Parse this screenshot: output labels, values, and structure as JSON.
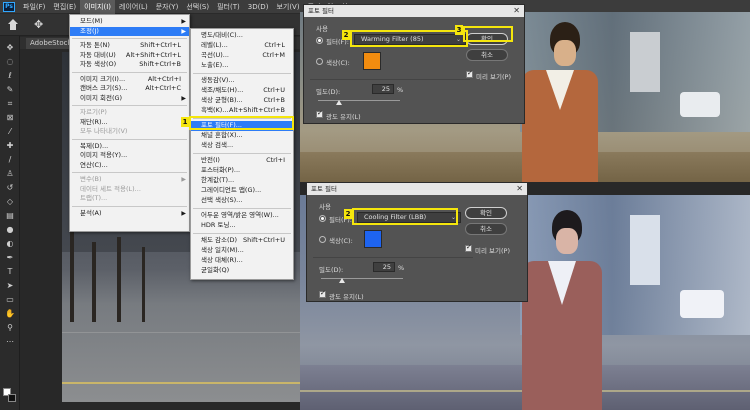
{
  "menubar": {
    "logo": "Ps",
    "items": [
      "파일(F)",
      "편집(E)",
      "이미지(I)",
      "레이어(L)",
      "문자(Y)",
      "선택(S)",
      "필터(T)",
      "3D(D)",
      "보기(V)",
      "플러그인",
      "창"
    ]
  },
  "document": {
    "tab_label": "AdobeStock_..."
  },
  "image_menu": {
    "rows": [
      {
        "label": "모드(M)",
        "shortcut": "",
        "submenu": true,
        "disabled": false
      },
      {
        "label": "조정(J)",
        "shortcut": "",
        "submenu": true,
        "disabled": false,
        "highlight": true
      },
      {
        "label": "자동 톤(N)",
        "shortcut": "Shift+Ctrl+L",
        "disabled": false
      },
      {
        "label": "자동 대비(U)",
        "shortcut": "Alt+Shift+Ctrl+L",
        "disabled": false
      },
      {
        "label": "자동 색상(O)",
        "shortcut": "Shift+Ctrl+B",
        "disabled": false
      },
      {
        "label": "이미지 크기(I)...",
        "shortcut": "Alt+Ctrl+I",
        "disabled": false
      },
      {
        "label": "캔버스 크기(S)...",
        "shortcut": "Alt+Ctrl+C",
        "disabled": false
      },
      {
        "label": "이미지 회전(G)",
        "shortcut": "",
        "submenu": true,
        "disabled": false
      },
      {
        "label": "자르기(P)",
        "shortcut": "",
        "disabled": true
      },
      {
        "label": "재단(R)...",
        "shortcut": "",
        "disabled": false
      },
      {
        "label": "모두 나타내기(V)",
        "shortcut": "",
        "disabled": true
      },
      {
        "label": "복제(D)...",
        "shortcut": "",
        "disabled": false
      },
      {
        "label": "이미지 적용(Y)...",
        "shortcut": "",
        "disabled": false
      },
      {
        "label": "연산(C)...",
        "shortcut": "",
        "disabled": false
      },
      {
        "label": "변수(B)",
        "shortcut": "",
        "submenu": true,
        "disabled": true
      },
      {
        "label": "데이터 세트 적용(L)...",
        "shortcut": "",
        "disabled": true
      },
      {
        "label": "트랩(T)...",
        "shortcut": "",
        "disabled": true
      },
      {
        "label": "분석(A)",
        "shortcut": "",
        "submenu": true,
        "disabled": false
      }
    ]
  },
  "adjust_menu": {
    "rows": [
      {
        "label": "명도/대비(C)...",
        "shortcut": ""
      },
      {
        "label": "레벨(L)...",
        "shortcut": "Ctrl+L"
      },
      {
        "label": "곡선(U)...",
        "shortcut": "Ctrl+M"
      },
      {
        "label": "노출(E)...",
        "shortcut": ""
      },
      {
        "label": "생동감(V)...",
        "shortcut": ""
      },
      {
        "label": "색조/채도(H)...",
        "shortcut": "Ctrl+U"
      },
      {
        "label": "색상 균형(B)...",
        "shortcut": "Ctrl+B"
      },
      {
        "label": "흑백(K)...",
        "shortcut": "Alt+Shift+Ctrl+B"
      },
      {
        "label": "포토 필터(F)...",
        "shortcut": "",
        "highlight": true
      },
      {
        "label": "채널 혼합(X)...",
        "shortcut": ""
      },
      {
        "label": "색상 검색...",
        "shortcut": ""
      },
      {
        "label": "반전(I)",
        "shortcut": "Ctrl+I"
      },
      {
        "label": "포스터화(P)...",
        "shortcut": ""
      },
      {
        "label": "한계값(T)...",
        "shortcut": ""
      },
      {
        "label": "그레이디언트 맵(G)...",
        "shortcut": ""
      },
      {
        "label": "선택 색상(S)...",
        "shortcut": ""
      },
      {
        "label": "어두운 영역/밝은 영역(W)...",
        "shortcut": ""
      },
      {
        "label": "HDR 토닝...",
        "shortcut": ""
      },
      {
        "label": "채도 감소(D)",
        "shortcut": "Shift+Ctrl+U"
      },
      {
        "label": "색상 일치(M)...",
        "shortcut": ""
      },
      {
        "label": "색상 대체(R)...",
        "shortcut": ""
      },
      {
        "label": "균일화(Q)",
        "shortcut": ""
      }
    ]
  },
  "dialog_warm": {
    "title": "포토 필터",
    "use_label": "사용",
    "filter_label": "필터(F):",
    "filter_value": "Warming Filter (85)",
    "color_label": "색상(C):",
    "color": "#f28c0f",
    "density_label": "밀도(D):",
    "density_value": "25",
    "density_unit": "%",
    "density_percent": 25,
    "preserve_label": "광도 유지(L)",
    "ok_label": "확인",
    "cancel_label": "취소",
    "preview_label": "미리 보기(P)"
  },
  "dialog_cool": {
    "title": "포토 필터",
    "use_label": "사용",
    "filter_label": "필터(F):",
    "filter_value": "Cooling Filter (LBB)",
    "color_label": "색상(C):",
    "color": "#1e64f0",
    "density_label": "밀도(D):",
    "density_value": "25",
    "density_unit": "%",
    "density_percent": 25,
    "preserve_label": "광도 유지(L)",
    "ok_label": "확인",
    "cancel_label": "취소",
    "preview_label": "미리 보기(P)"
  },
  "annotations": {
    "step1": "1",
    "step2_top": "2",
    "step3": "3",
    "step2_bottom": "2"
  },
  "colors": {
    "annotation_yellow": "#f5e60c",
    "menu_highlight": "#2d7cf6",
    "warm_tint": "#f28c0f",
    "cool_tint": "#1e64f0"
  }
}
